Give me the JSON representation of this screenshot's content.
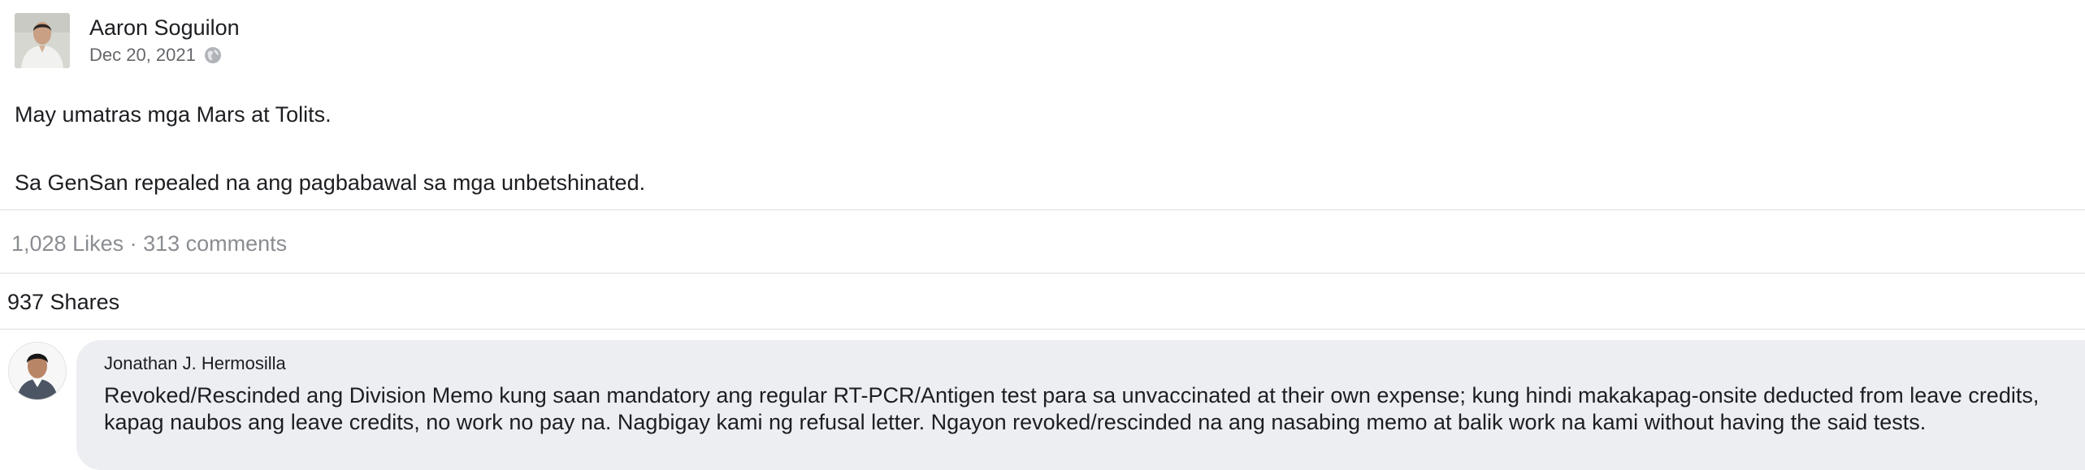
{
  "post": {
    "author": "Aaron Soguilon",
    "date": "Dec 20, 2021",
    "privacy_icon": "globe-icon",
    "paragraphs": [
      "May umatras mga Mars at Tolits.",
      "Sa GenSan repealed na ang pagbabawal sa mga unbetshinated."
    ]
  },
  "stats": {
    "likes_comments": "1,028 Likes · 313 comments",
    "shares": "937 Shares"
  },
  "comment": {
    "author": "Jonathan J. Hermosilla",
    "text": "Revoked/Rescinded ang Division Memo kung saan mandatory ang regular RT-PCR/Antigen test para sa unvaccinated at their own expense; kung hindi makakapag-onsite deducted from leave credits, kapag naubos ang leave credits, no work no pay na. Nagbigay kami ng refusal letter. Ngayon revoked/rescinded na ang nasabing memo at balik work na kami without having the said tests."
  },
  "colors": {
    "text": "#1c1e21",
    "meta": "#65676b",
    "muted": "#8a8d91",
    "divider": "#dadde1",
    "comment_bubble": "#eceef1"
  }
}
